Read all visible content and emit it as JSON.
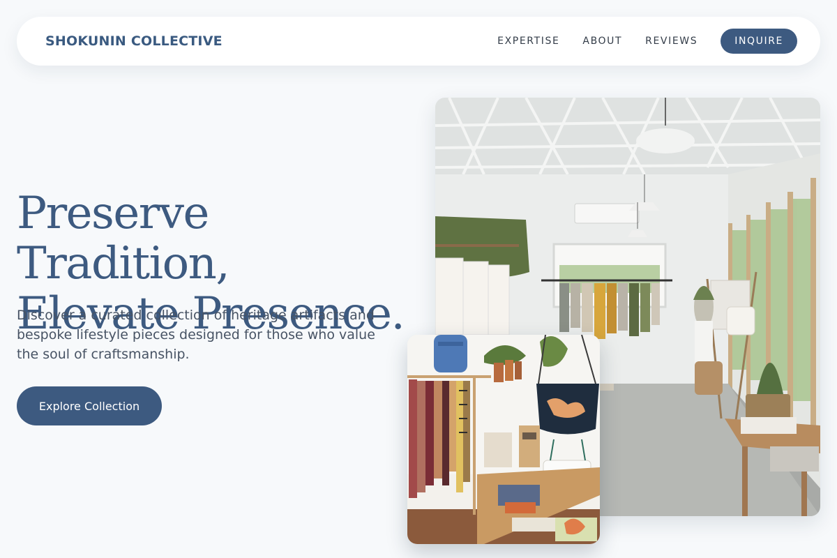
{
  "nav": {
    "brand": "SHOKUNIN COLLECTIVE",
    "links": [
      "EXPERTISE",
      "ABOUT",
      "REVIEWS"
    ],
    "cta": "INQUIRE"
  },
  "hero": {
    "title_line1": "Preserve Tradition,",
    "title_line2": "Elevate Presence.",
    "subtitle": "Discover a curated collection of heritage artifacts and bespoke lifestyle pieces designed for those who value the soul of craftsmanship.",
    "cta": "Explore Collection"
  },
  "colors": {
    "accent": "#3d5a80",
    "background": "#f7f9fb",
    "text": "#475364"
  }
}
